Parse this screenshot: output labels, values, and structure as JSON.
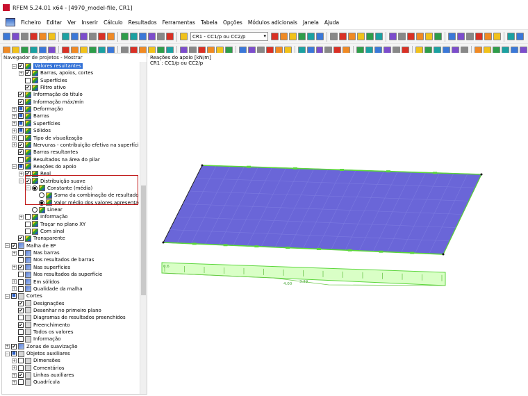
{
  "window": {
    "title": "RFEM 5.24.01 x64 - [4970_model-file, CR1]"
  },
  "menu": [
    "Ficheiro",
    "Editar",
    "Ver",
    "Inserir",
    "Cálculo",
    "Resultados",
    "Ferramentas",
    "Tabela",
    "Opções",
    "Módulos adicionais",
    "Janela",
    "Ajuda"
  ],
  "toolbar": {
    "load_case_select": "CR1 - CC1/p ou CC2/p"
  },
  "navigator": {
    "title": "Navegador de projetos - Mostrar",
    "items": [
      {
        "label": "Valores resultantes",
        "level": 1,
        "exp": "−",
        "cb": "✔",
        "icon": "g1",
        "selected": true
      },
      {
        "label": "Barras, apoios, cortes",
        "level": 2,
        "exp": "+",
        "cb": "✔",
        "icon": "g1"
      },
      {
        "label": "Superfícies",
        "level": 2,
        "cb": "",
        "icon": "g1"
      },
      {
        "label": "Filtro ativo",
        "level": 2,
        "cb": "✔",
        "icon": "g1"
      },
      {
        "label": "Informação do título",
        "level": 1,
        "cb": "✔",
        "icon": "g1"
      },
      {
        "label": "Informação máx/mín",
        "level": 1,
        "cb": "✔",
        "icon": "g1"
      },
      {
        "label": "Deformação",
        "level": 1,
        "exp": "+",
        "cb": "■",
        "icon": "g1"
      },
      {
        "label": "Barras",
        "level": 1,
        "exp": "+",
        "cb": "■",
        "icon": "g1"
      },
      {
        "label": "Superfícies",
        "level": 1,
        "exp": "+",
        "cb": "■",
        "icon": "g1"
      },
      {
        "label": "Sólidos",
        "level": 1,
        "exp": "+",
        "cb": "■",
        "icon": "g1"
      },
      {
        "label": "Tipo de visualização",
        "level": 1,
        "exp": "+",
        "cb": "",
        "icon": "g1"
      },
      {
        "label": "Nervuras - contribuição efetiva na superfície/barra",
        "level": 1,
        "exp": "+",
        "cb": "✔",
        "icon": "g1"
      },
      {
        "label": "Barras resultantes",
        "level": 1,
        "cb": "✔",
        "icon": "g1"
      },
      {
        "label": "Resultados na área do pilar",
        "level": 1,
        "cb": "",
        "icon": "g1"
      },
      {
        "label": "Reações do apoio",
        "level": 1,
        "exp": "−",
        "cb": "■",
        "icon": "g1"
      },
      {
        "label": "Real",
        "level": 2,
        "exp": "+",
        "cb": "✔",
        "icon": "g1"
      },
      {
        "label": "Distribuição suave",
        "level": 2,
        "exp": "−",
        "cb": "✔",
        "icon": "g1"
      },
      {
        "label": "Constante (média)",
        "level": 3,
        "exp": "−",
        "rd": "on",
        "icon": "g1"
      },
      {
        "label": "Soma da combinação de resultados",
        "level": 4,
        "rd": "off",
        "icon": "g1"
      },
      {
        "label": "Valor médio dos valores apresentados",
        "level": 4,
        "rd": "on",
        "icon": "g1"
      },
      {
        "label": "Linear",
        "level": 3,
        "rd": "off",
        "icon": "g1"
      },
      {
        "label": "Informação",
        "level": 2,
        "exp": "+",
        "cb": "",
        "icon": "g1"
      },
      {
        "label": "Traçar no plano XY",
        "level": 2,
        "cb": "",
        "icon": "g1"
      },
      {
        "label": "Com sinal",
        "level": 2,
        "cb": "",
        "icon": "g1"
      },
      {
        "label": "Transparente",
        "level": 1,
        "cb": "✔",
        "icon": "g1"
      },
      {
        "label": "Malha de EF",
        "level": 0,
        "exp": "−",
        "cb": "✔",
        "icon": "g2"
      },
      {
        "label": "Nas barras",
        "level": 1,
        "exp": "+",
        "cb": "",
        "icon": "g2"
      },
      {
        "label": "Nos resultados de barras",
        "level": 1,
        "cb": "",
        "icon": "g2"
      },
      {
        "label": "Nas superfícies",
        "level": 1,
        "exp": "+",
        "cb": "✔",
        "icon": "g2"
      },
      {
        "label": "Nos resultados da superfície",
        "level": 1,
        "cb": "",
        "icon": "g2"
      },
      {
        "label": "Em sólidos",
        "level": 1,
        "exp": "+",
        "cb": "",
        "icon": "g2"
      },
      {
        "label": "Qualidade da malha",
        "level": 1,
        "exp": "+",
        "cb": "",
        "icon": "g2"
      },
      {
        "label": "Cortes",
        "level": 0,
        "exp": "−",
        "cb": "■",
        "icon": "g3"
      },
      {
        "label": "Designações",
        "level": 1,
        "cb": "✔",
        "icon": "g3"
      },
      {
        "label": "Desenhar no primeiro plano",
        "level": 1,
        "cb": "✔",
        "icon": "g3"
      },
      {
        "label": "Diagramas de resultados preenchidos",
        "level": 1,
        "cb": "",
        "icon": "g3"
      },
      {
        "label": "Preenchimento",
        "level": 1,
        "cb": "✔",
        "icon": "g3"
      },
      {
        "label": "Todos os valores",
        "level": 1,
        "cb": "",
        "icon": "g3"
      },
      {
        "label": "Informação",
        "level": 1,
        "cb": "",
        "icon": "g3"
      },
      {
        "label": "Zonas de suavização",
        "level": 0,
        "exp": "+",
        "cb": "✔",
        "icon": "g2"
      },
      {
        "label": "Objetos auxiliares",
        "level": 0,
        "exp": "−",
        "cb": "■",
        "icon": "g3"
      },
      {
        "label": "Dimensões",
        "level": 1,
        "exp": "+",
        "cb": "",
        "icon": "g3"
      },
      {
        "label": "Comentários",
        "level": 1,
        "exp": "+",
        "cb": "",
        "icon": "g3"
      },
      {
        "label": "Linhas auxiliares",
        "level": 1,
        "exp": "+",
        "cb": "✔",
        "icon": "g3"
      },
      {
        "label": "Quadrícula",
        "level": 1,
        "exp": "+",
        "cb": "",
        "icon": "g3"
      }
    ]
  },
  "viewport": {
    "title": "Reações do apoio [kN/m]",
    "subtitle": "CR1 : CC1/p ou CC2/p",
    "labels": [
      "0.6",
      "4.00",
      "3.29"
    ],
    "colors": {
      "plate": "#6a66d8",
      "edge": "#5cd63c",
      "diagram_fill": "#d9ffc6"
    }
  }
}
